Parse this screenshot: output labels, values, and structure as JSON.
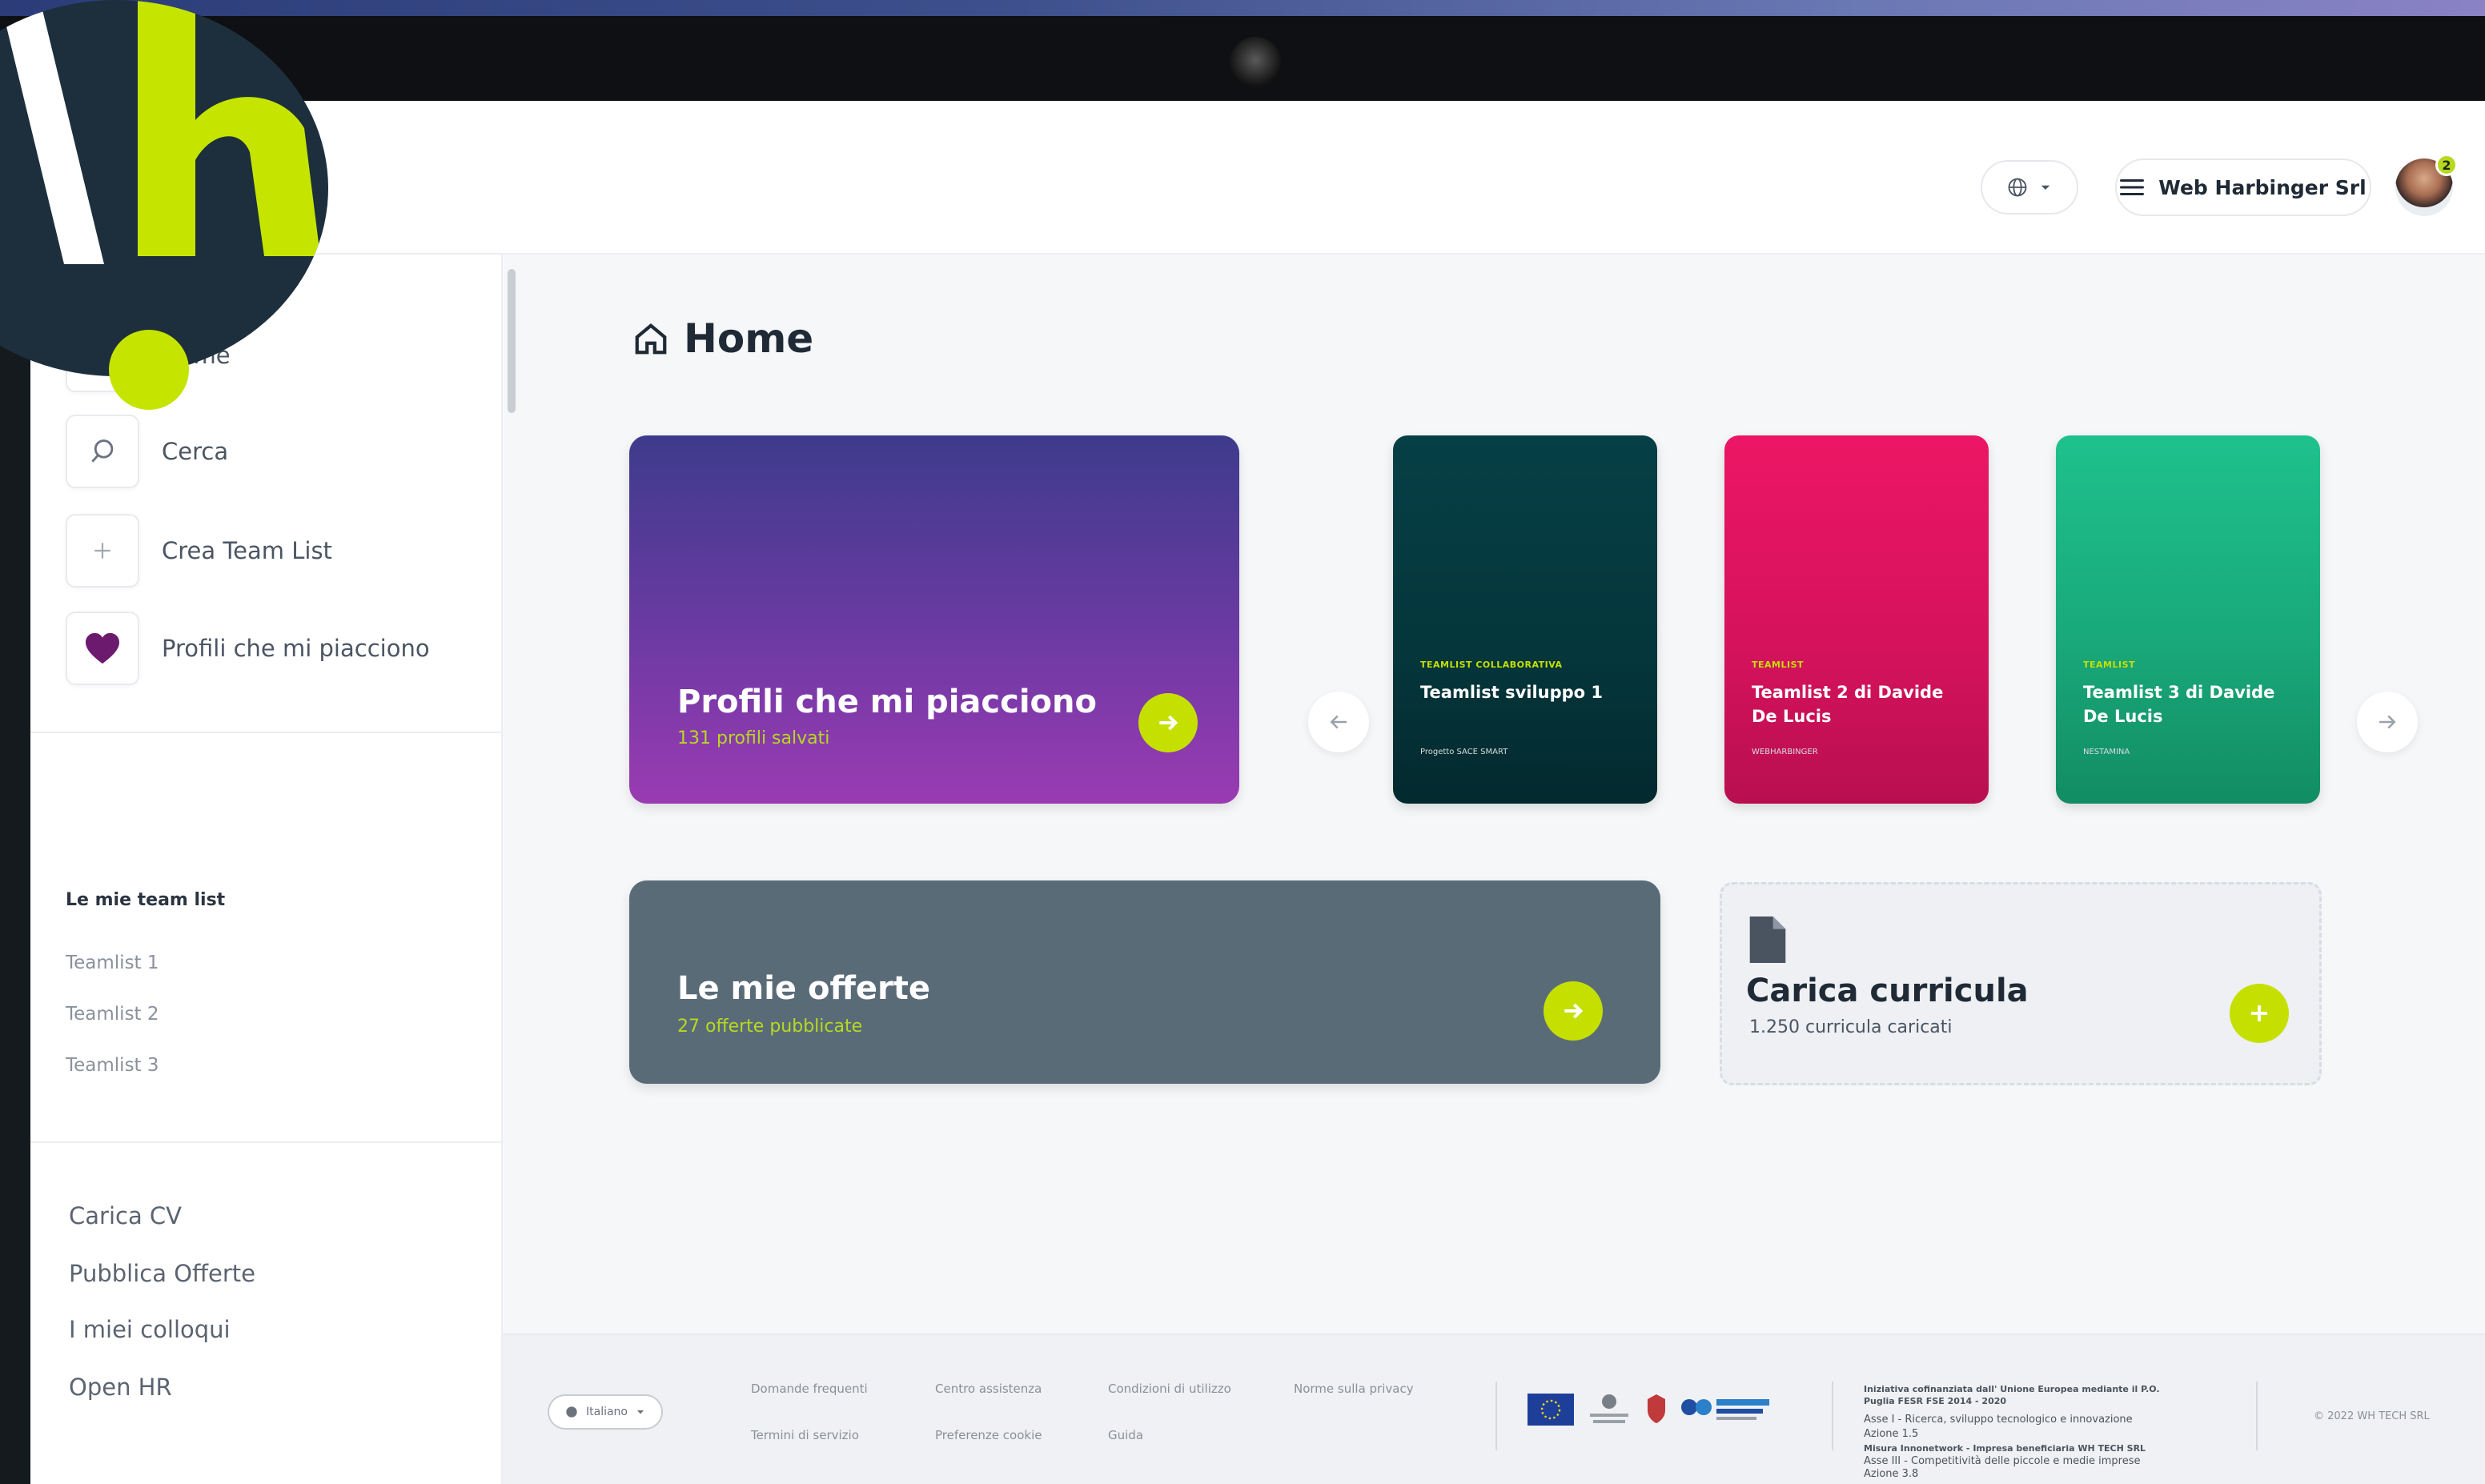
{
  "header": {
    "company_name": "Web Harbinger Srl",
    "notification_count": "2"
  },
  "sidebar": {
    "nav": [
      {
        "label": "Home"
      },
      {
        "label": "Cerca"
      },
      {
        "label": "Crea Team List"
      },
      {
        "label": "Profili che mi piacciono"
      }
    ],
    "section_title": "Le mie team list",
    "teamlists": [
      "Teamlist 1",
      "Teamlist 2",
      "Teamlist 3"
    ],
    "bottom_links": [
      "Carica CV",
      "Pubblica Offerte",
      "I miei colloqui",
      "Open HR"
    ]
  },
  "main": {
    "page_title": "Home",
    "liked_card": {
      "title": "Profili che mi piacciono",
      "subtitle": "131 profili salvati"
    },
    "teamlists": [
      {
        "tag": "TEAMLIST COLLABORATIVA",
        "name": "Teamlist sviluppo 1",
        "meta": "Progetto SACE SMART"
      },
      {
        "tag": "TEAMLIST",
        "name": "Teamlist 2 di Davide De Lucis",
        "meta": "WEBHARBINGER"
      },
      {
        "tag": "TEAMLIST",
        "name": "Teamlist 3 di Davide De Lucis",
        "meta": "NESTAMINA"
      }
    ],
    "offers_card": {
      "title": "Le mie offerte",
      "subtitle": "27 offerte pubblicate"
    },
    "cv_card": {
      "title": "Carica curricula",
      "subtitle": "1.250 curricula caricati"
    }
  },
  "footer": {
    "language": "Italiano",
    "links": [
      "Domande frequenti",
      "Centro assistenza",
      "Condizioni di utilizzo",
      "Norme sulla privacy",
      "Termini di servizio",
      "Preferenze cookie",
      "Guida"
    ],
    "legal_title": "Iniziativa cofinanziata dall' Unione Europea mediante il P.O. Puglia FESR FSE 2014 - 2020",
    "legal_asse1": "Asse I - Ricerca, sviluppo tecnologico e innovazione",
    "legal_azione1": "Azione 1.5",
    "legal_asse3": "Asse III - Competitività delle piccole e medie imprese",
    "legal_azione3": "Azione 3.8",
    "legal_beneficiary": "Misura Innonetwork - Impresa beneficiaria WH TECH SRL",
    "copyright": "© 2022 WH TECH SRL"
  },
  "colors": {
    "accent": "#c5e000",
    "liked_card": "#6d3aa3",
    "teamlist_1": "#04363b",
    "teamlist_2": "#d4125c",
    "teamlist_3": "#19a97a",
    "offers_card": "#5a6b78"
  }
}
